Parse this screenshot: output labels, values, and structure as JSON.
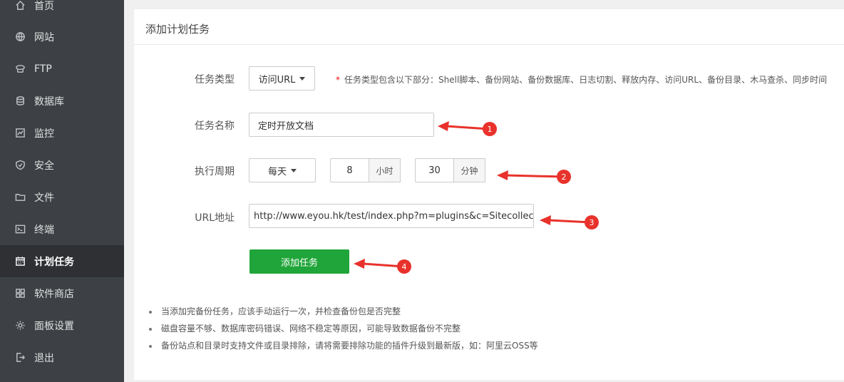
{
  "sidebar": {
    "items": [
      {
        "label": "首页",
        "icon": "home-icon"
      },
      {
        "label": "网站",
        "icon": "globe-icon"
      },
      {
        "label": "FTP",
        "icon": "ftp-icon"
      },
      {
        "label": "数据库",
        "icon": "database-icon"
      },
      {
        "label": "监控",
        "icon": "monitor-icon"
      },
      {
        "label": "安全",
        "icon": "shield-icon"
      },
      {
        "label": "文件",
        "icon": "folder-icon"
      },
      {
        "label": "终端",
        "icon": "terminal-icon"
      },
      {
        "label": "计划任务",
        "icon": "calendar-icon",
        "active": true
      },
      {
        "label": "软件商店",
        "icon": "grid-icon"
      },
      {
        "label": "面板设置",
        "icon": "gear-icon"
      },
      {
        "label": "退出",
        "icon": "logout-icon"
      }
    ]
  },
  "panel": {
    "title": "添加计划任务"
  },
  "form": {
    "task_type_label": "任务类型",
    "task_type_value": "访问URL",
    "task_type_note_star": "*",
    "task_type_note": "任务类型包含以下部分：Shell脚本、备份网站、备份数据库、日志切割、释放内存、访问URL、备份目录、木马查杀、同步时间",
    "task_name_label": "任务名称",
    "task_name_value": "定时开放文档",
    "period_label": "执行周期",
    "period_value": "每天",
    "hour_value": "8",
    "hour_unit": "小时",
    "minute_value": "30",
    "minute_unit": "分钟",
    "url_label": "URL地址",
    "url_value": "http://www.eyou.hk/test/index.php?m=plugins&c=Sitecollect&a=timing",
    "submit_label": "添加任务"
  },
  "tips": [
    "当添加完备份任务，应该手动运行一次，并检查备份包是否完整",
    "磁盘容量不够、数据库密码错误、网络不稳定等原因，可能导致数据备份不完整",
    "备份站点和目录时支持文件或目录排除，请将需要排除功能的插件升级到最新版，如：阿里云OSS等"
  ],
  "annotations": {
    "color": "#e8322b",
    "numbers": [
      "1",
      "2",
      "3",
      "4"
    ]
  }
}
